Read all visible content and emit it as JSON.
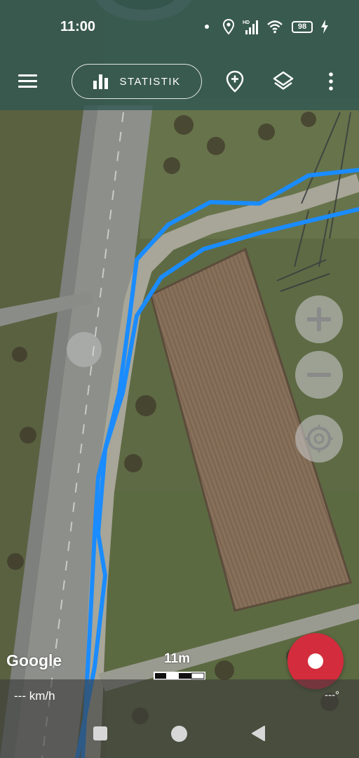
{
  "status_bar": {
    "time": "11:00",
    "hd_label": "HD",
    "battery_level": "98",
    "icons": [
      "notification-dot-icon",
      "location-icon",
      "signal-icon",
      "wifi-icon",
      "battery-icon",
      "charging-icon"
    ]
  },
  "toolbar": {
    "menu_icon": "hamburger-menu-icon",
    "stats_label": "STATISTIK",
    "stats_icon": "bar-chart-icon",
    "add_poi_icon": "add-location-icon",
    "layers_icon": "layers-icon",
    "more_icon": "more-vertical-icon"
  },
  "map": {
    "type": "satellite",
    "attribution": "Google",
    "scale_label": "11m",
    "track_color": "#1a8cff",
    "controls": {
      "zoom_in_icon": "plus-icon",
      "zoom_out_icon": "minus-icon",
      "locate_icon": "crosshair-icon"
    }
  },
  "record": {
    "icon": "record-dot-icon",
    "color": "#d32c3d"
  },
  "info_panel": {
    "speed": "--- km/h",
    "bearing": "---°"
  },
  "nav_bar": {
    "recent_icon": "square-icon",
    "home_icon": "circle-icon",
    "back_icon": "triangle-back-icon"
  }
}
